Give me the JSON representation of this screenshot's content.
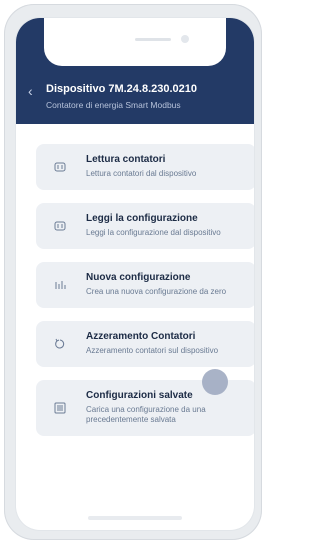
{
  "device": {
    "title": "Dispositivo 7M.24.8.230.0210",
    "subtitle": "Contatore di energia Smart Modbus"
  },
  "menu": [
    {
      "title": "Lettura contatori",
      "description": "Lettura contatori dal dispositivo",
      "icon": "meter-read-icon"
    },
    {
      "title": "Leggi la configurazione",
      "description": "Leggi la configurazione dal dispositivo",
      "icon": "meter-read-icon"
    },
    {
      "title": "Nuova configurazione",
      "description": "Crea una nuova configurazione da zero",
      "icon": "new-config-icon"
    },
    {
      "title": "Azzeramento Contatori",
      "description": "Azzeramento contatori sul dispositivo",
      "icon": "reset-icon"
    },
    {
      "title": "Configurazioni salvate",
      "description": "Carica una configurazione da una precedentemente salvata",
      "icon": "saved-configs-icon"
    }
  ],
  "colors": {
    "header": "#233a66",
    "card": "#edf0f4",
    "title_text": "#1c2b45",
    "desc_text": "#697a92"
  }
}
